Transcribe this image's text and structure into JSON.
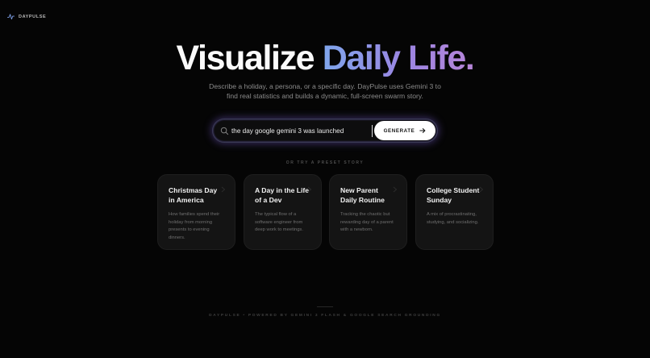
{
  "brand": {
    "name": "DAYPULSE",
    "icon": "pulse-icon"
  },
  "hero": {
    "title_main": "Visualize",
    "title_accent": "Daily Life.",
    "subtitle_line1": "Describe a holiday, a persona, or a specific day. DayPulse uses Gemini 3 to",
    "subtitle_line2": "find real statistics and builds a dynamic, full-screen swarm story."
  },
  "search": {
    "icon": "search-icon",
    "value": "the day google gemini 3 was launched",
    "button_label": "GENERATE",
    "button_icon": "arrow-right-icon"
  },
  "presets": {
    "label": "OR TRY A PRESET STORY",
    "items": [
      {
        "title": "Christmas Day in America",
        "description": "How families spend their holiday from morning presents to evening dinners."
      },
      {
        "title": "A Day in the Life of a Dev",
        "description": "The typical flow of a software engineer from deep work to meetings."
      },
      {
        "title": "New Parent Daily Routine",
        "description": "Tracking the chaotic but rewarding day of a parent with a newborn."
      },
      {
        "title": "College Student Sunday",
        "description": "A mix of procrastinating, studying, and socializing."
      }
    ]
  },
  "footer": {
    "text": "DAYPULSE • POWERED BY GEMINI 3 FLASH & GOOGLE SEARCH GROUNDING"
  },
  "colors": {
    "background": "#050505",
    "accent_start": "#7fa6ec",
    "accent_end": "#b685d8",
    "glow": "#7a60d2"
  }
}
